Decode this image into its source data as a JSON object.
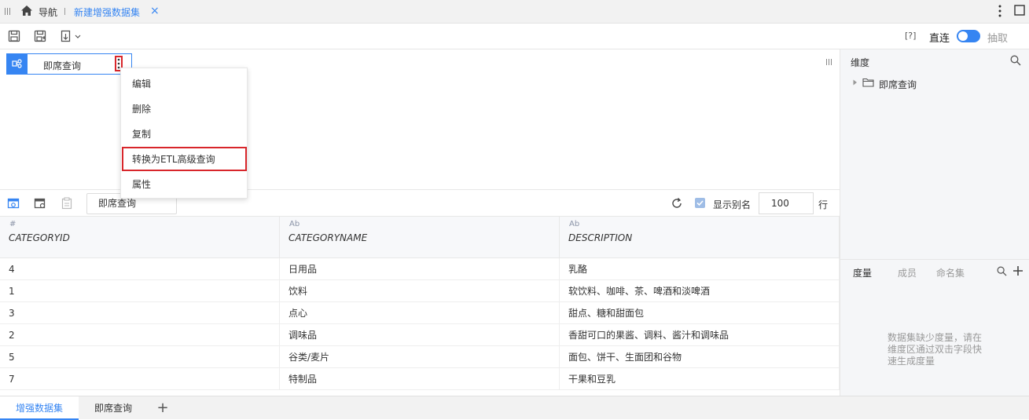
{
  "topbar": {
    "nav_label": "导航",
    "active_tab_label": "新建增强数据集",
    "close_symbol": "×"
  },
  "toolbar": {
    "help_label": "[?]",
    "direct_label": "直连",
    "extract_label": "抽取",
    "accent_color": "#3685f2"
  },
  "canvas": {
    "node_label": "即席查询"
  },
  "context_menu": {
    "items": [
      "编辑",
      "删除",
      "复制",
      "转换为ETL高级查询",
      "属性"
    ],
    "highlight_color": "#d8262b"
  },
  "preview": {
    "query_tab_label": "即席查询",
    "show_alias_label": "显示别名",
    "show_alias_checked": true,
    "rows_value": "100",
    "rows_unit": "行"
  },
  "table": {
    "columns": [
      {
        "type_symbol": "#",
        "label": "CATEGORYID"
      },
      {
        "type_symbol": "Ab",
        "label": "CATEGORYNAME"
      },
      {
        "type_symbol": "Ab",
        "label": "DESCRIPTION"
      }
    ],
    "rows": [
      [
        "4",
        "日用品",
        "乳酪"
      ],
      [
        "1",
        "饮料",
        "软饮料、咖啡、茶、啤酒和淡啤酒"
      ],
      [
        "3",
        "点心",
        "甜点、糖和甜面包"
      ],
      [
        "2",
        "调味品",
        "香甜可口的果酱、调料、酱汁和调味品"
      ],
      [
        "5",
        "谷类/麦片",
        "面包、饼干、生面团和谷物"
      ],
      [
        "7",
        "特制品",
        "干果和豆乳"
      ]
    ]
  },
  "right_panel": {
    "dimension_title": "维度",
    "tree_item": "即席查询",
    "measure_tabs": [
      "度量",
      "成员",
      "命名集"
    ],
    "empty_message": "数据集缺少度量，请在维度区通过双击字段快速生成度量"
  },
  "bottom_tabs": {
    "tabs": [
      "增强数据集",
      "即席查询"
    ],
    "add_symbol": "+"
  }
}
